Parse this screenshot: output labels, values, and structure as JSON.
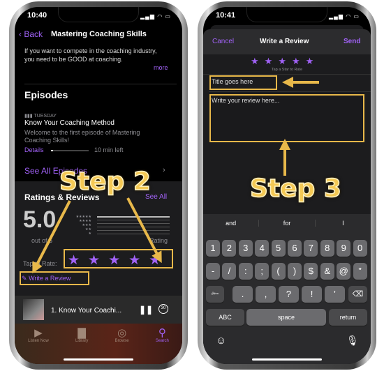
{
  "left_phone": {
    "time": "10:40",
    "nav": {
      "back": "Back",
      "title": "Mastering Coaching Skills"
    },
    "description": [
      "If you want to compete in the coaching industry,",
      "you need to be GOOD at coaching."
    ],
    "more": "more",
    "episodes": {
      "heading": "Episodes",
      "day": "TUESDAY",
      "title": "Know Your Coaching Method",
      "desc": [
        "Welcome to the first episode of Mastering",
        "Coaching Skills!"
      ],
      "details": "Details",
      "remaining": "10 min left",
      "progress": 0.05,
      "see_all": "See All Episodes"
    },
    "ratings": {
      "heading": "Ratings & Reviews",
      "see_all": "See All",
      "score": "5.0",
      "out_of": "out of 5",
      "count_label": "Rating",
      "tap_to_rate": "Tap to Rate:",
      "stars_selected": 5,
      "write_review": "Write a Review"
    },
    "mini_player": {
      "title": "1. Know Your Coachi...",
      "skip": "30"
    },
    "tabs": [
      {
        "label": "Listen Now"
      },
      {
        "label": "Library"
      },
      {
        "label": "Browse"
      },
      {
        "label": "Search",
        "active": true
      }
    ]
  },
  "right_phone": {
    "time": "10:41",
    "header": {
      "cancel": "Cancel",
      "title": "Write a Review",
      "send": "Send"
    },
    "stars_selected": 5,
    "tap_hint": "Tap a Star to Rate",
    "title_placeholder": "Title goes here",
    "review_placeholder": "Write your review here...",
    "suggestions": [
      "and",
      "for",
      "I"
    ],
    "keys": {
      "row1": [
        "1",
        "2",
        "3",
        "4",
        "5",
        "6",
        "7",
        "8",
        "9",
        "0"
      ],
      "row2": [
        "-",
        "/",
        ":",
        ";",
        "(",
        ")",
        "$",
        "&",
        "@",
        "”"
      ],
      "row3_left": "#+=",
      "row3": [
        ".",
        ",",
        "?",
        "!",
        "’"
      ],
      "abc": "ABC",
      "space": "space",
      "return": "return"
    }
  },
  "annotations": {
    "step2": "Step 2",
    "step3": "Step 3"
  },
  "colors": {
    "accent": "#a162f7",
    "highlight": "#e8b84a"
  }
}
